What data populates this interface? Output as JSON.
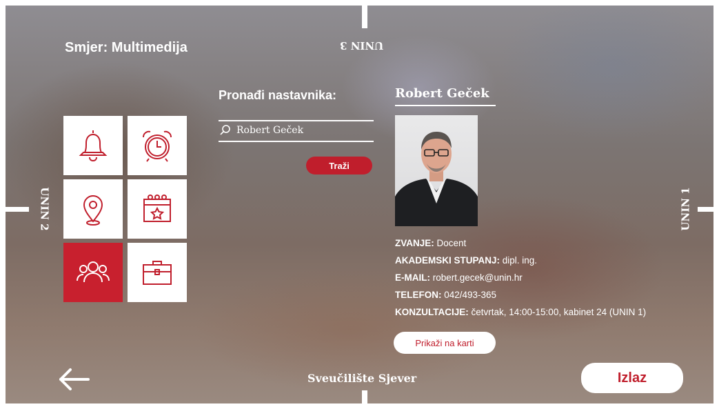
{
  "header": {
    "program_label": "Smjer: Multimedija"
  },
  "campus_labels": {
    "top": "UNIN 3",
    "left": "UNIN 2",
    "right": "UNIN 1",
    "bottom": "Sveučilište Sjever"
  },
  "search": {
    "title": "Pronađi nastavnika:",
    "value": "Robert Geček",
    "button_label": "Traži"
  },
  "tiles": [
    {
      "icon": "bell-icon",
      "active": false
    },
    {
      "icon": "alarm-clock-icon",
      "active": false
    },
    {
      "icon": "location-pin-icon",
      "active": false
    },
    {
      "icon": "calendar-star-icon",
      "active": false
    },
    {
      "icon": "people-icon",
      "active": true
    },
    {
      "icon": "briefcase-icon",
      "active": false
    }
  ],
  "teacher": {
    "name": "Robert Geček",
    "rows": [
      {
        "label": "ZVANJE:",
        "value": " Docent"
      },
      {
        "label": "AKADEMSKI STUPANJ:",
        "value": " dipl. ing."
      },
      {
        "label": "E-MAIL:",
        "value": " robert.gecek@unin.hr"
      },
      {
        "label": "TELEFON:",
        "value": " 042/493-365"
      },
      {
        "label": "KONZULTACIJE:",
        "value": " četvrtak, 14:00-15:00, kabinet 24 (UNIN 1)"
      }
    ],
    "map_button_label": "Prikaži na karti"
  },
  "footer": {
    "exit_label": "Izlaz",
    "back_icon": "arrow-left-icon"
  },
  "colors": {
    "accent": "#c01e2c",
    "tile_active": "#c8202e",
    "white": "#ffffff"
  }
}
